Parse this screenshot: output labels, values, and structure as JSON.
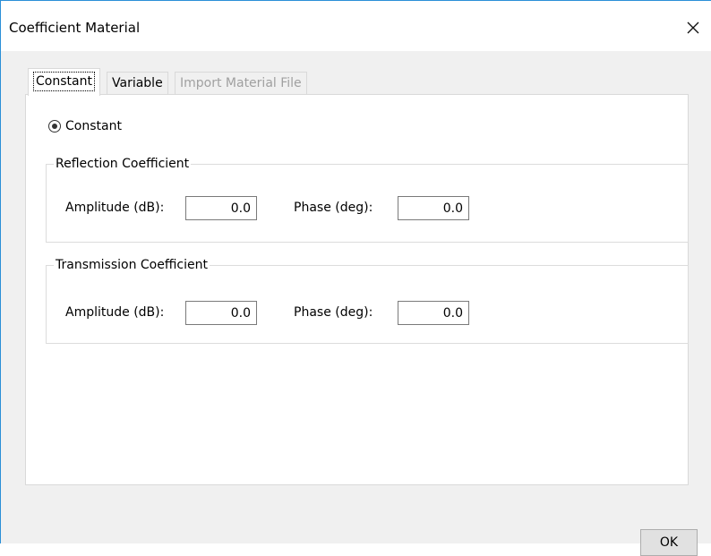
{
  "window": {
    "title": "Coefficient Material",
    "close_icon": "close-icon"
  },
  "tabs": [
    {
      "label": "Constant",
      "state": "active"
    },
    {
      "label": "Variable",
      "state": "normal"
    },
    {
      "label": "Import Material File",
      "state": "disabled"
    }
  ],
  "constant_panel": {
    "radio_label": "Constant",
    "radio_selected": true,
    "reflection": {
      "title": "Reflection Coefficient",
      "amplitude_label": "Amplitude (dB):",
      "amplitude_value": "0.0",
      "phase_label": "Phase (deg):",
      "phase_value": "0.0"
    },
    "transmission": {
      "title": "Transmission Coefficient",
      "amplitude_label": "Amplitude (dB):",
      "amplitude_value": "0.0",
      "phase_label": "Phase (deg):",
      "phase_value": "0.0"
    }
  },
  "footer": {
    "ok_label": "OK"
  },
  "colors": {
    "title_border": "#2b8fd7",
    "disabled_text": "#a0a0a0"
  }
}
